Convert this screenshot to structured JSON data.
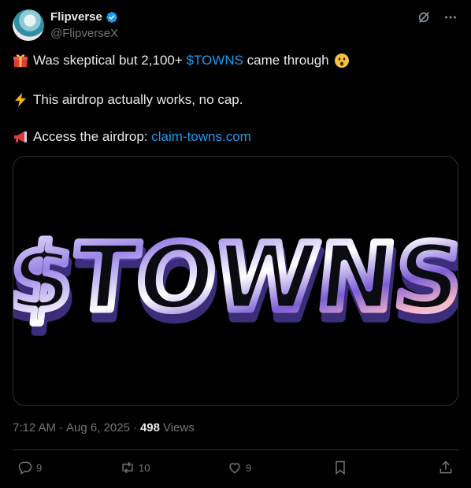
{
  "header": {
    "display_name": "Flipverse",
    "handle": "@FlipverseX",
    "verified": true,
    "icons": [
      "grok-icon",
      "more-icon"
    ]
  },
  "body": {
    "line1": {
      "emoji": "gift-emoji",
      "text_before": "Was skeptical but 2,100+ ",
      "cashtag": "$TOWNS",
      "text_after": " came through",
      "emoji_after": "astonished-face-emoji"
    },
    "line2": {
      "emoji": "lightning-emoji",
      "text": "This airdrop actually works, no cap."
    },
    "line3": {
      "emoji": "megaphone-emoji",
      "text_before": "Access the airdrop: ",
      "link": "claim-towns.com"
    }
  },
  "media": {
    "image_text": "$TOWNS"
  },
  "meta": {
    "time": "7:12 AM",
    "sep1": "·",
    "date": "Aug 6, 2025",
    "sep2": "·",
    "views_count": "498",
    "views_label": "Views"
  },
  "actions": {
    "replies": "9",
    "reposts": "10",
    "likes": "9"
  },
  "colors": {
    "accent": "#1d9bf0",
    "text": "#e7e9ea",
    "muted": "#71767b",
    "border": "#2f3336"
  }
}
